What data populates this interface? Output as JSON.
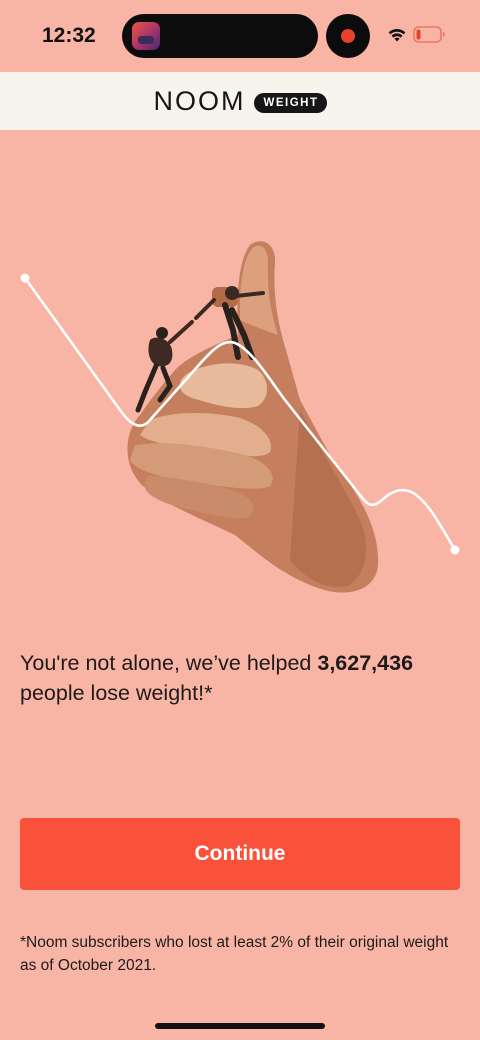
{
  "status_bar": {
    "time": "12:32",
    "icons": [
      "recording-app-icon",
      "record-indicator-icon",
      "wifi-icon",
      "battery-low-icon"
    ],
    "battery_color": "#E8402F"
  },
  "header": {
    "logo_text": "NOOM",
    "logo_badge": "WEIGHT",
    "background": "#F7F4EE"
  },
  "hero": {
    "image": "hand-thumbs-up-climbers-illustration",
    "line_color": "#FFFFFF"
  },
  "main": {
    "headline_prefix": "You're not alone, we’ve helped ",
    "headline_count": "3,627,436",
    "headline_suffix": " people lose weight!*",
    "continue_label": "Continue",
    "footnote": "*Noom subscribers who lost at least 2% of their original weight as of October 2021."
  },
  "colors": {
    "background": "#F8B5A5",
    "accent": "#FA523A",
    "text": "#1F1A1A"
  }
}
